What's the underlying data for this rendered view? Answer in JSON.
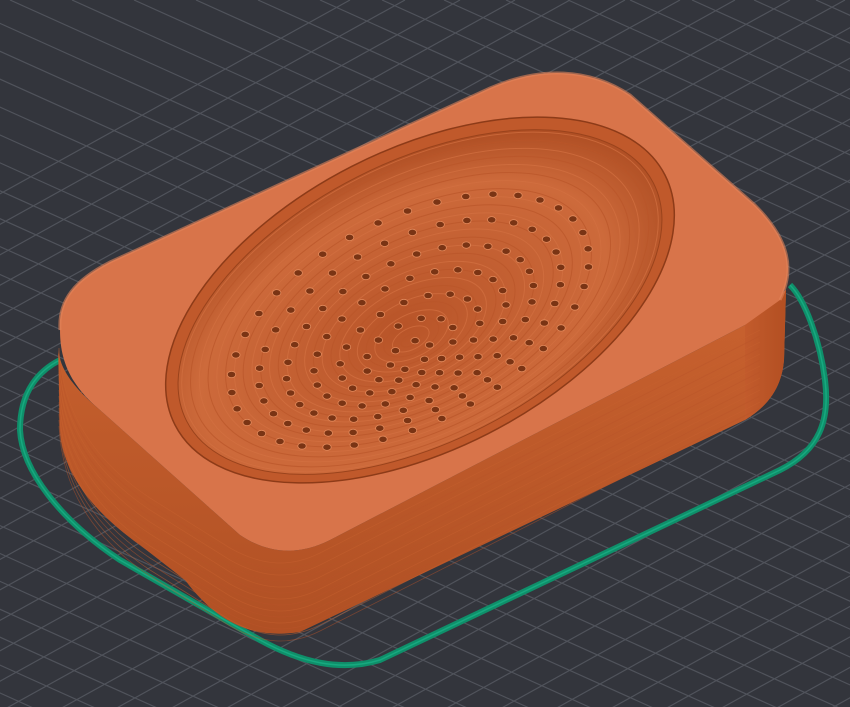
{
  "scene": {
    "background_color": "#33353c",
    "grid_color": "#50535b",
    "grid_line_color_major": "#5a5d66",
    "skirt_color": "#0f8f6a",
    "skirt_highlight": "#17a97f",
    "body_top_color": "#d8744a",
    "body_side_color": "#c25b2c",
    "body_side_dark": "#a9491f",
    "bowl_color": "#c86536",
    "bowl_dark": "#a84c22",
    "hole_color": "#7a3414",
    "hole_rim_color": "#e38a5c"
  }
}
